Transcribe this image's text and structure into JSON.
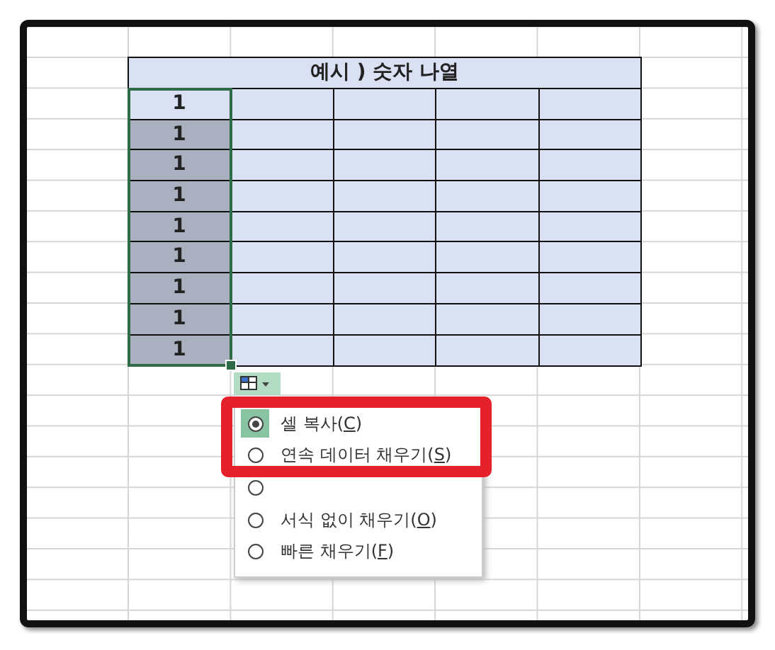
{
  "table": {
    "title": "예시 ) 숫자 나열",
    "rows": [
      {
        "value": "1",
        "selected": true,
        "active": true
      },
      {
        "value": "1",
        "selected": true,
        "active": false
      },
      {
        "value": "1",
        "selected": true,
        "active": false
      },
      {
        "value": "1",
        "selected": true,
        "active": false
      },
      {
        "value": "1",
        "selected": true,
        "active": false
      },
      {
        "value": "1",
        "selected": true,
        "active": false
      },
      {
        "value": "1",
        "selected": true,
        "active": false
      },
      {
        "value": "1",
        "selected": true,
        "active": false
      },
      {
        "value": "1",
        "selected": true,
        "active": false
      }
    ]
  },
  "autofill_menu": {
    "items": [
      {
        "prefix": "셀 복사(",
        "key": "C",
        "suffix": ")",
        "selected": true
      },
      {
        "prefix": "연속 데이터 채우기(",
        "key": "S",
        "suffix": ")",
        "selected": false
      },
      {
        "selected": false
      },
      {
        "prefix": "서식 없이 채우기(",
        "key": "O",
        "suffix": ")",
        "selected": false
      },
      {
        "prefix": "빠른 채우기(",
        "key": "F",
        "suffix": ")",
        "selected": false
      }
    ]
  },
  "highlight": {
    "shown": true
  }
}
